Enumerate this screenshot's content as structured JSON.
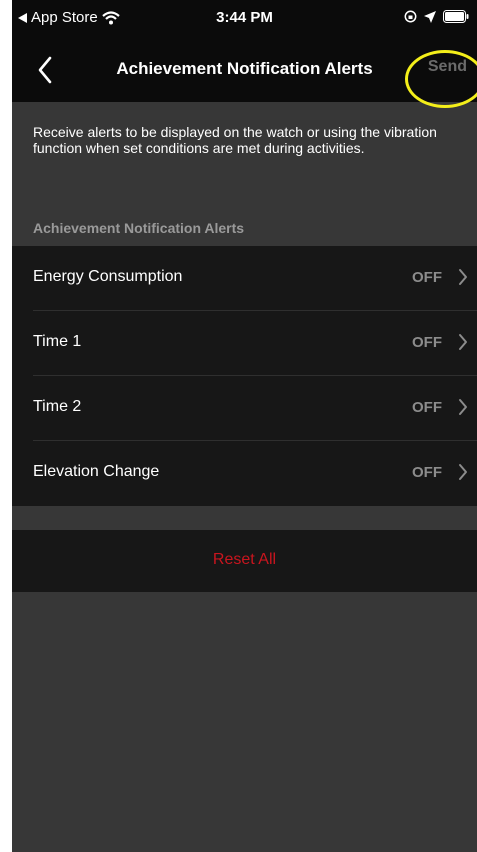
{
  "status_bar": {
    "back_app": "App Store",
    "time": "3:44 PM"
  },
  "nav": {
    "title": "Achievement Notification Alerts",
    "send_label": "Send"
  },
  "description": "Receive alerts to be displayed on the watch or using the vibration function when set conditions are met during activities.",
  "section_header": "Achievement Notification Alerts",
  "items": [
    {
      "label": "Energy Consumption",
      "value": "OFF"
    },
    {
      "label": "Time 1",
      "value": "OFF"
    },
    {
      "label": "Time 2",
      "value": "OFF"
    },
    {
      "label": "Elevation Change",
      "value": "OFF"
    }
  ],
  "reset_label": "Reset All",
  "colors": {
    "background": "#373737",
    "bar": "#0b0b0b",
    "list": "#171717",
    "reset": "#c8151e",
    "highlight": "#f4ef1a"
  }
}
